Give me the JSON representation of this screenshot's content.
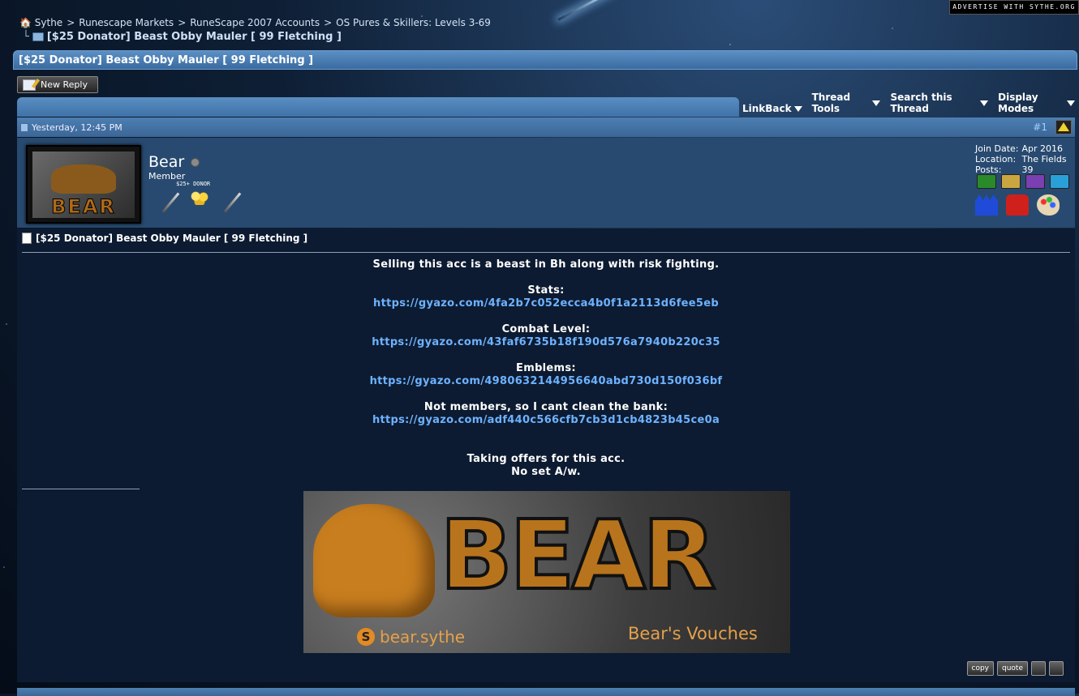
{
  "advertise": "ADVERTISE WITH SYTHE.ORG",
  "breadcrumb": {
    "items": [
      "Sythe",
      "Runescape Markets",
      "RuneScape 2007 Accounts",
      "OS Pures & Skillers: Levels 3-69"
    ],
    "separator": ">",
    "current": "[$25 Donator] Beast Obby Mauler [ 99 Fletching ]"
  },
  "thread": {
    "title": "[$25 Donator] Beast Obby Mauler [ 99 Fletching ]",
    "new_reply_label": "New Reply"
  },
  "toolbar": {
    "linkback": "LinkBack",
    "thread_tools": "Thread Tools",
    "search_thread": "Search this Thread",
    "display_modes": "Display Modes"
  },
  "post": {
    "date": "Yesterday, 12:45 PM",
    "number": "#1",
    "user": {
      "name": "Bear",
      "title": "Member",
      "rank_label": "$25+ DONOR",
      "avatar_text": "BEAR",
      "join_date_label": "Join Date:",
      "join_date": "Apr 2016",
      "location_label": "Location:",
      "location": "The Fields",
      "posts_label": "Posts:",
      "posts": "39"
    },
    "title": "[$25 Donator] Beast Obby Mauler [ 99 Fletching ]",
    "body": {
      "intro": "Selling this acc is a beast in Bh along with risk fighting.",
      "stats_label": "Stats:",
      "stats_link": "https://gyazo.com/4fa2b7c052ecca4b0f1a2113d6fee5eb",
      "combat_label": "Combat Level:",
      "combat_link": "https://gyazo.com/43faf6735b18f190d576a7940b220c35",
      "emblems_label": "Emblems:",
      "emblems_link": "https://gyazo.com/4980632144956640abd730d150f036bf",
      "bank_label": "Not members, so I cant clean the bank:",
      "bank_link": "https://gyazo.com/adf440c566cfb7cb3d1cb4823b45ce0a",
      "offers": "Taking offers for this acc.",
      "aw": "No set A/w."
    },
    "signature": {
      "banner_text": "BEAR",
      "skype": "bear.sythe",
      "skype_icon": "S",
      "vouches": "Bear's Vouches"
    },
    "buttons": {
      "copy": "copy",
      "quote": "quote"
    }
  },
  "colors": {
    "link": "#6eb2ff",
    "header_blue": "#4d7fb2",
    "post_bg": "#0c1b31",
    "userbar": "#284a70"
  }
}
